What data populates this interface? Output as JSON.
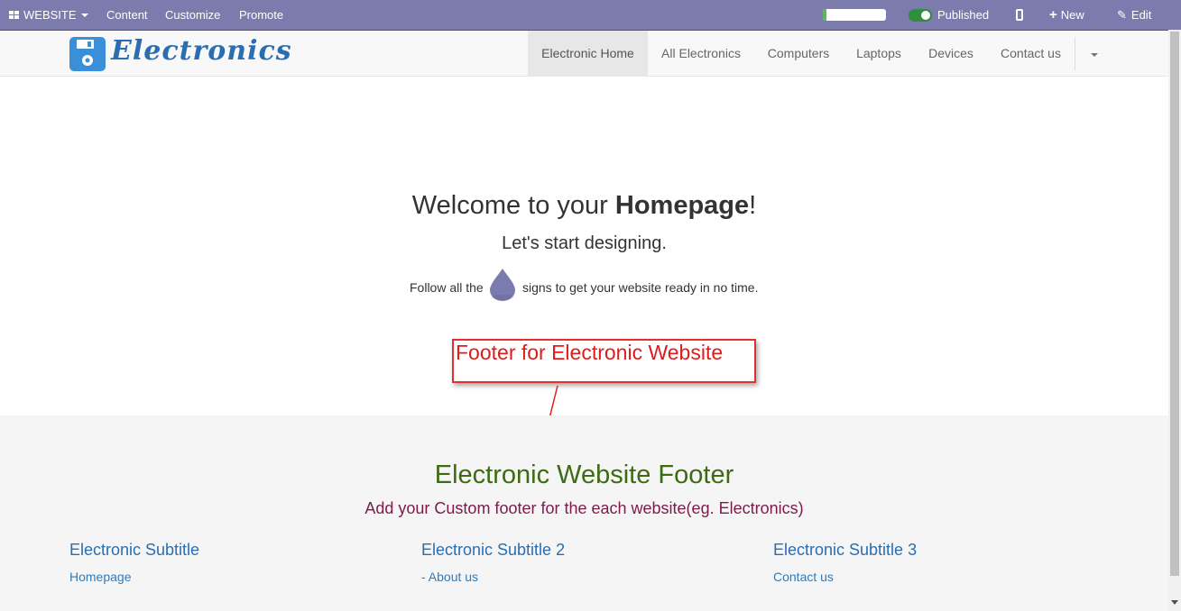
{
  "admin_bar": {
    "website_menu": "WEBSITE",
    "menu_items": [
      "Content",
      "Customize",
      "Promote"
    ],
    "progress_fraction": 0.06,
    "published_label": "Published",
    "published_on": true,
    "new_label": "New",
    "edit_label": "Edit"
  },
  "site": {
    "logo_text": "Electronics",
    "nav_items": [
      "Electronic Home",
      "All Electronics",
      "Computers",
      "Laptops",
      "Devices",
      "Contact us"
    ],
    "active_nav": "Electronic Home"
  },
  "hero": {
    "welcome_prefix": "Welcome to your ",
    "welcome_bold": "Homepage",
    "welcome_suffix": "!",
    "subtitle": "Let's start designing.",
    "follow_before": "Follow all the",
    "follow_after": "signs to get your website ready in no time."
  },
  "annotation": {
    "text": "Footer for Electronic Website"
  },
  "footer": {
    "title": "Electronic Website Footer",
    "tagline": "Add your Custom footer for the each website(eg. Electronics)",
    "columns": [
      {
        "title": "Electronic Subtitle",
        "link": "Homepage"
      },
      {
        "title": "Electronic Subtitle 2",
        "link": "- About us"
      },
      {
        "title": "Electronic Subtitle 3",
        "link": "Contact us"
      }
    ]
  },
  "colors": {
    "admin_bar": "#7c7bad",
    "logo_blue": "#2a6db0",
    "annotation_red": "#e01b1b",
    "footer_title_green": "#3d6b12",
    "footer_tagline": "#7a1b4a"
  }
}
